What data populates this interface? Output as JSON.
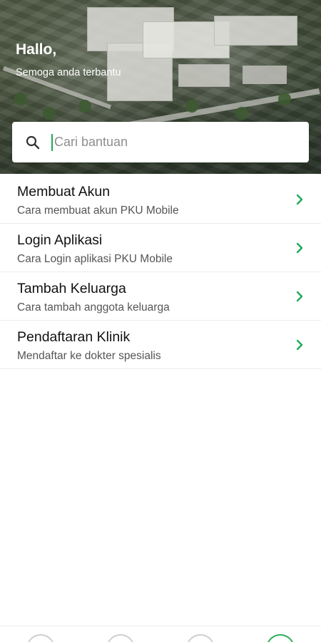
{
  "header": {
    "greeting": "Hallo,",
    "subtitle": "Semoga anda terbantu"
  },
  "search": {
    "placeholder": "Cari bantuan",
    "value": ""
  },
  "help_items": [
    {
      "title": "Membuat Akun",
      "subtitle": "Cara membuat akun PKU Mobile"
    },
    {
      "title": "Login Aplikasi",
      "subtitle": "Cara Login aplikasi PKU Mobile"
    },
    {
      "title": "Tambah Keluarga",
      "subtitle": "Cara tambah anggota keluarga"
    },
    {
      "title": "Pendaftaran Klinik",
      "subtitle": "Mendaftar ke dokter spesialis"
    }
  ],
  "colors": {
    "accent": "#1faa59",
    "chevron": "#1faa59"
  },
  "icons": {
    "search": "search-icon",
    "chevron": "chevron-right-icon"
  }
}
